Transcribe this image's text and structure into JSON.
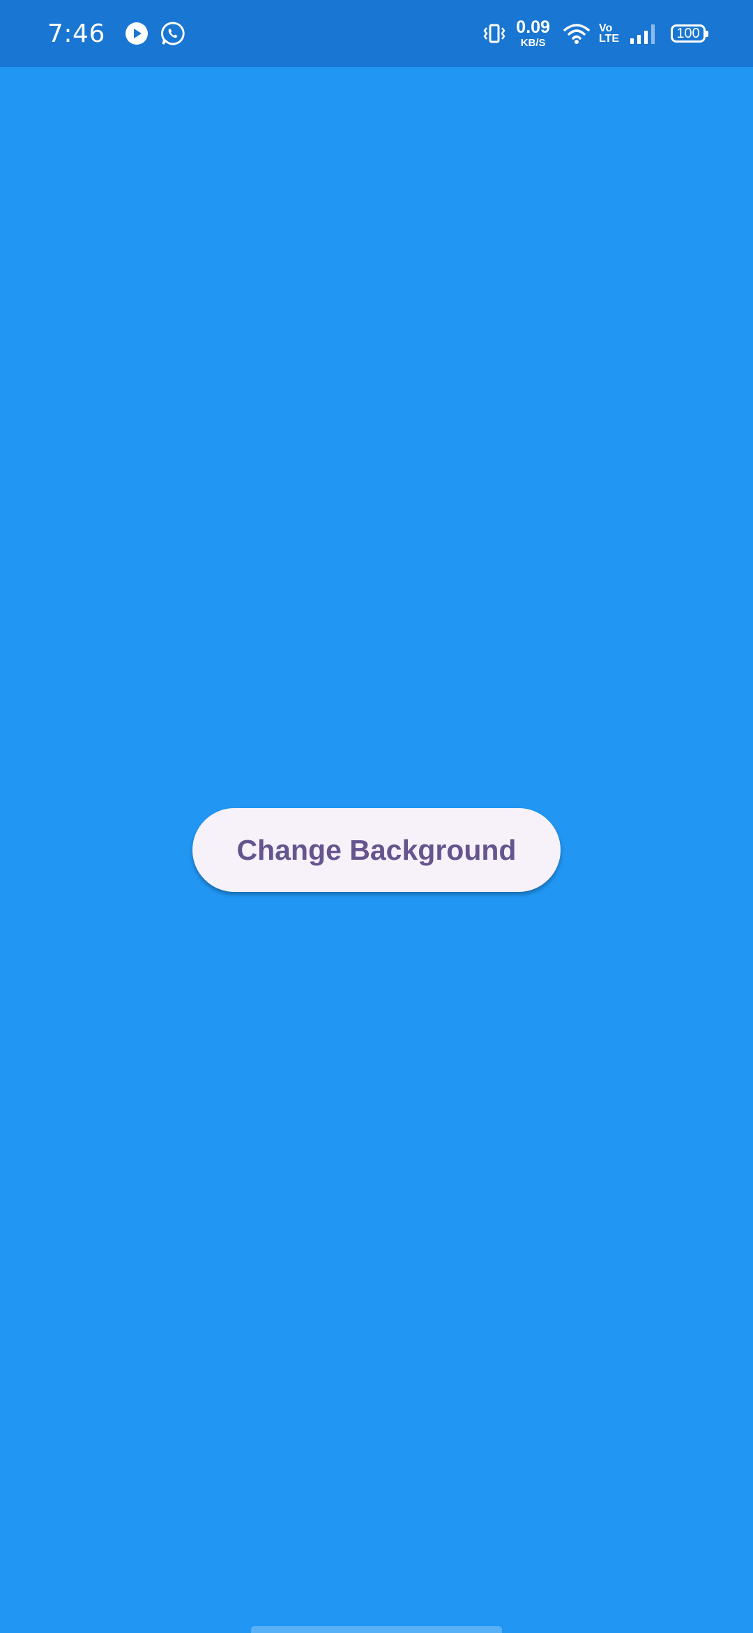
{
  "status_bar": {
    "time": "7:46",
    "notifications": [
      "play-icon",
      "whatsapp-icon"
    ],
    "net_speed_value": "0.09",
    "net_speed_unit": "KB/S",
    "volte_line1": "Vo",
    "volte_line2": "LTE",
    "battery_level": "100"
  },
  "main": {
    "button_label": "Change Background"
  },
  "colors": {
    "background": "#2196F3",
    "status_bar": "#1976D2",
    "button_bg": "#F7F2FA",
    "button_text": "#65558F"
  }
}
